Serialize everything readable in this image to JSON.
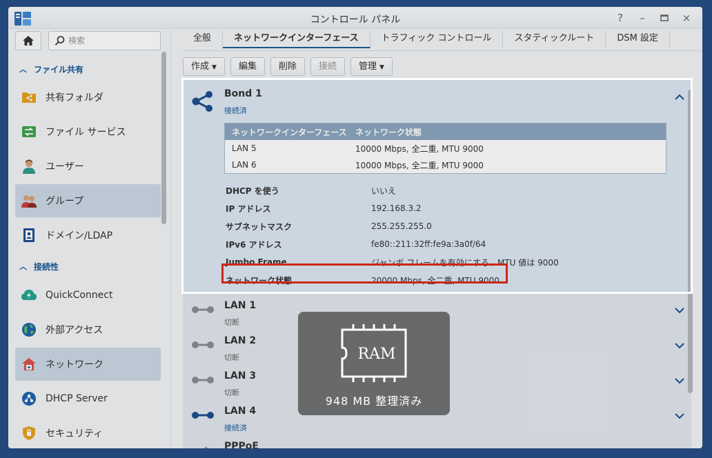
{
  "window": {
    "title": "コントロール パネル"
  },
  "window_controls": [
    "?",
    "–",
    "□",
    "×"
  ],
  "sidebar": {
    "search_placeholder": "検索",
    "sections": [
      {
        "label": "ファイル共有"
      },
      {
        "label": "接続性"
      }
    ],
    "items": [
      {
        "label": "共有フォルダ",
        "icon": "shared-folder-icon"
      },
      {
        "label": "ファイル サービス",
        "icon": "file-services-icon"
      },
      {
        "label": "ユーザー",
        "icon": "user-icon"
      },
      {
        "label": "グループ",
        "icon": "group-icon"
      },
      {
        "label": "ドメイン/LDAP",
        "icon": "domain-ldap-icon"
      },
      {
        "label": "QuickConnect",
        "icon": "quickconnect-icon"
      },
      {
        "label": "外部アクセス",
        "icon": "external-access-icon"
      },
      {
        "label": "ネットワーク",
        "icon": "network-icon"
      },
      {
        "label": "DHCP Server",
        "icon": "dhcp-server-icon"
      },
      {
        "label": "セキュリティ",
        "icon": "security-icon"
      }
    ]
  },
  "tabs": [
    "全般",
    "ネットワークインターフェース",
    "トラフィック コントロール",
    "スタティックルート",
    "DSM 設定"
  ],
  "toolbar": {
    "create": "作成",
    "edit": "編集",
    "delete": "削除",
    "connect": "接続",
    "manage": "管理"
  },
  "bond": {
    "title": "Bond 1",
    "status": "接続済",
    "table_headers": [
      "ネットワークインターフェース",
      "ネットワーク状態"
    ],
    "table_rows": [
      {
        "iface": "LAN 5",
        "state": "10000 Mbps, 全二重, MTU 9000"
      },
      {
        "iface": "LAN 6",
        "state": "10000 Mbps, 全二重, MTU 9000"
      }
    ],
    "details": [
      {
        "key": "DHCP を使う",
        "value": "いいえ"
      },
      {
        "key": "IP アドレス",
        "value": "192.168.3.2"
      },
      {
        "key": "サブネットマスク",
        "value": "255.255.255.0"
      },
      {
        "key": "IPv6 アドレス",
        "value": "fe80::211:32ff:fe9a:3a0f/64"
      },
      {
        "key": "Jumbo Frame",
        "value": "ジャンボ フレームを有効にする、MTU 値は 9000"
      },
      {
        "key": "ネットワーク状態",
        "value": "20000 Mbps, 全二重, MTU 9000"
      }
    ]
  },
  "interfaces": [
    {
      "name": "LAN 1",
      "status": "切断"
    },
    {
      "name": "LAN 2",
      "status": "切断"
    },
    {
      "name": "LAN 3",
      "status": "切断"
    },
    {
      "name": "LAN 4",
      "status": "接続済"
    },
    {
      "name": "PPPoE",
      "status": ""
    }
  ],
  "ram_toast": {
    "chip_label": "RAM",
    "message": "948 MB 整理済み"
  },
  "colors": {
    "accent": "#1a5a99",
    "highlight": "#e02a1a",
    "selected": "#cbd9e7"
  }
}
